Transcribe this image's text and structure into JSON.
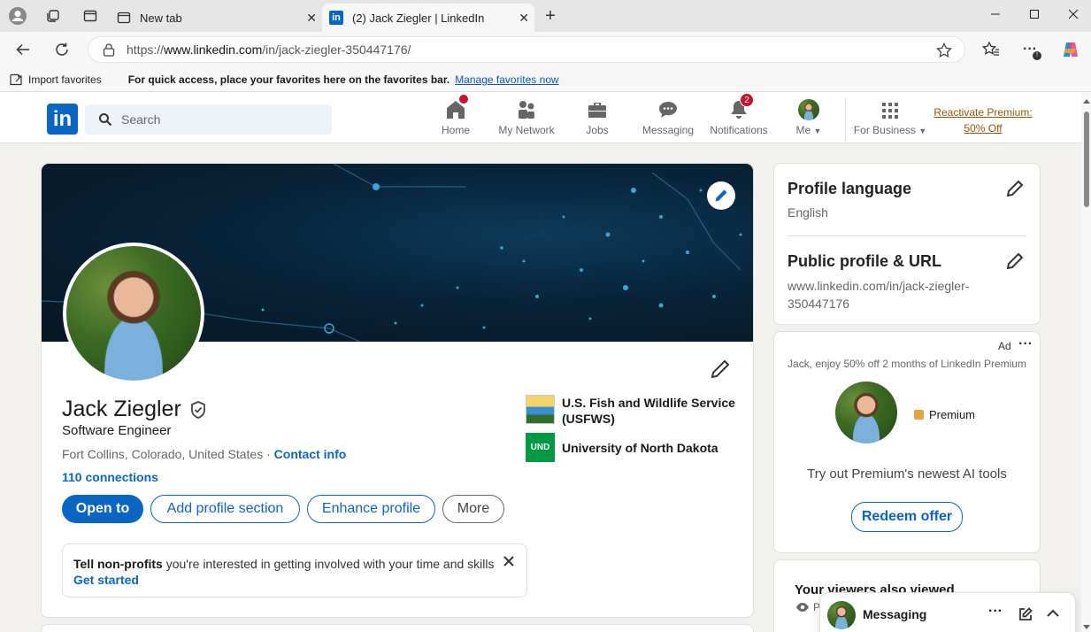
{
  "browser": {
    "tabs": [
      {
        "title": "New tab"
      },
      {
        "title": "(2) Jack Ziegler | LinkedIn"
      }
    ],
    "address": {
      "prefix": "https://",
      "domain": "www.linkedin.com",
      "path": "/in/jack-ziegler-350447176/"
    },
    "favorites_bar": {
      "import_label": "Import favorites",
      "message": "For quick access, place your favorites here on the favorites bar.",
      "manage_link": "Manage favorites now"
    }
  },
  "linkedin_nav": {
    "logo": "in",
    "search_placeholder": "Search",
    "items": [
      {
        "label": "Home",
        "icon": "home-icon"
      },
      {
        "label": "My Network",
        "icon": "people-icon"
      },
      {
        "label": "Jobs",
        "icon": "briefcase-icon"
      },
      {
        "label": "Messaging",
        "icon": "chat-icon"
      },
      {
        "label": "Notifications",
        "icon": "bell-icon",
        "badge": "2"
      },
      {
        "label": "Me",
        "icon": "avatar"
      },
      {
        "label": "For Business",
        "icon": "grid-icon"
      }
    ],
    "premium_line1": "Reactivate Premium:",
    "premium_line2": "50% Off"
  },
  "profile": {
    "name": "Jack Ziegler",
    "headline": "Software Engineer",
    "location": "Fort Collins, Colorado, United States",
    "separator": "·",
    "contact_info": "Contact info",
    "connections": "110 connections",
    "buttons": {
      "open_to": "Open to",
      "add_section": "Add profile section",
      "enhance": "Enhance profile",
      "more": "More"
    },
    "experience": [
      {
        "name_line1": "U.S. Fish and Wildlife Service",
        "name_line2": "(USFWS)"
      },
      {
        "name_line1": "University of North Dakota",
        "logo_text": "UND"
      }
    ],
    "notice": {
      "bold": "Tell non-profits",
      "text": " you're interested in getting involved with your time and skills",
      "cta": "Get started"
    }
  },
  "sidebar": {
    "profile_language": {
      "title": "Profile language",
      "value": "English"
    },
    "public_profile": {
      "title": "Public profile & URL",
      "line1": "www.linkedin.com/in/jack-ziegler-",
      "line2": "350447176"
    },
    "ad": {
      "label": "Ad",
      "text": "Jack, enjoy 50% off 2 months of LinkedIn Premium",
      "premium": "Premium",
      "tagline": "Try out Premium's newest AI tools",
      "cta": "Redeem offer"
    },
    "viewers_title": "Your viewers also viewed",
    "viewers_sub": "P"
  },
  "messaging": {
    "label": "Messaging"
  },
  "colors": {
    "brand": "#0a66c2",
    "banner": "#082338",
    "badge": "#cb112d",
    "premium": "#915907"
  }
}
